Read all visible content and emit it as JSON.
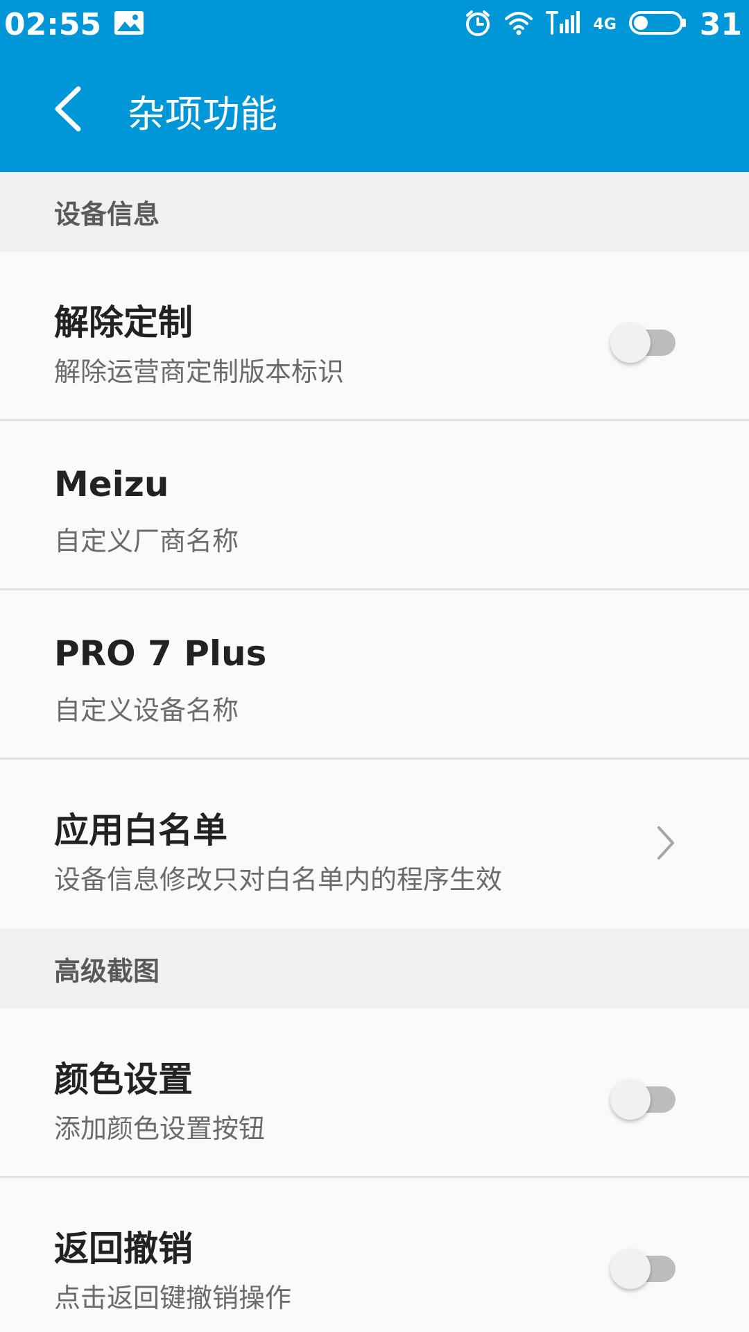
{
  "status_bar": {
    "time": "02:55",
    "network_label": "4G",
    "battery_level": "31",
    "icons": [
      "image-icon",
      "alarm-icon",
      "wifi-icon",
      "signal-icon",
      "battery-icon"
    ]
  },
  "header": {
    "title": "杂项功能",
    "background_color": "#0097d8"
  },
  "sections": [
    {
      "label": "设备信息",
      "items": [
        {
          "title": "解除定制",
          "subtitle": "解除运营商定制版本标识",
          "control": "toggle",
          "enabled": false
        },
        {
          "title": "Meizu",
          "subtitle": "自定义厂商名称",
          "control": "none"
        },
        {
          "title": "PRO 7 Plus",
          "subtitle": "自定义设备名称",
          "control": "none"
        },
        {
          "title": "应用白名单",
          "subtitle": "设备信息修改只对白名单内的程序生效",
          "control": "chevron"
        }
      ]
    },
    {
      "label": "高级截图",
      "items": [
        {
          "title": "颜色设置",
          "subtitle": "添加颜色设置按钮",
          "control": "toggle",
          "enabled": false
        },
        {
          "title": "返回撤销",
          "subtitle": "点击返回键撤销操作",
          "control": "toggle",
          "enabled": false
        }
      ]
    }
  ]
}
